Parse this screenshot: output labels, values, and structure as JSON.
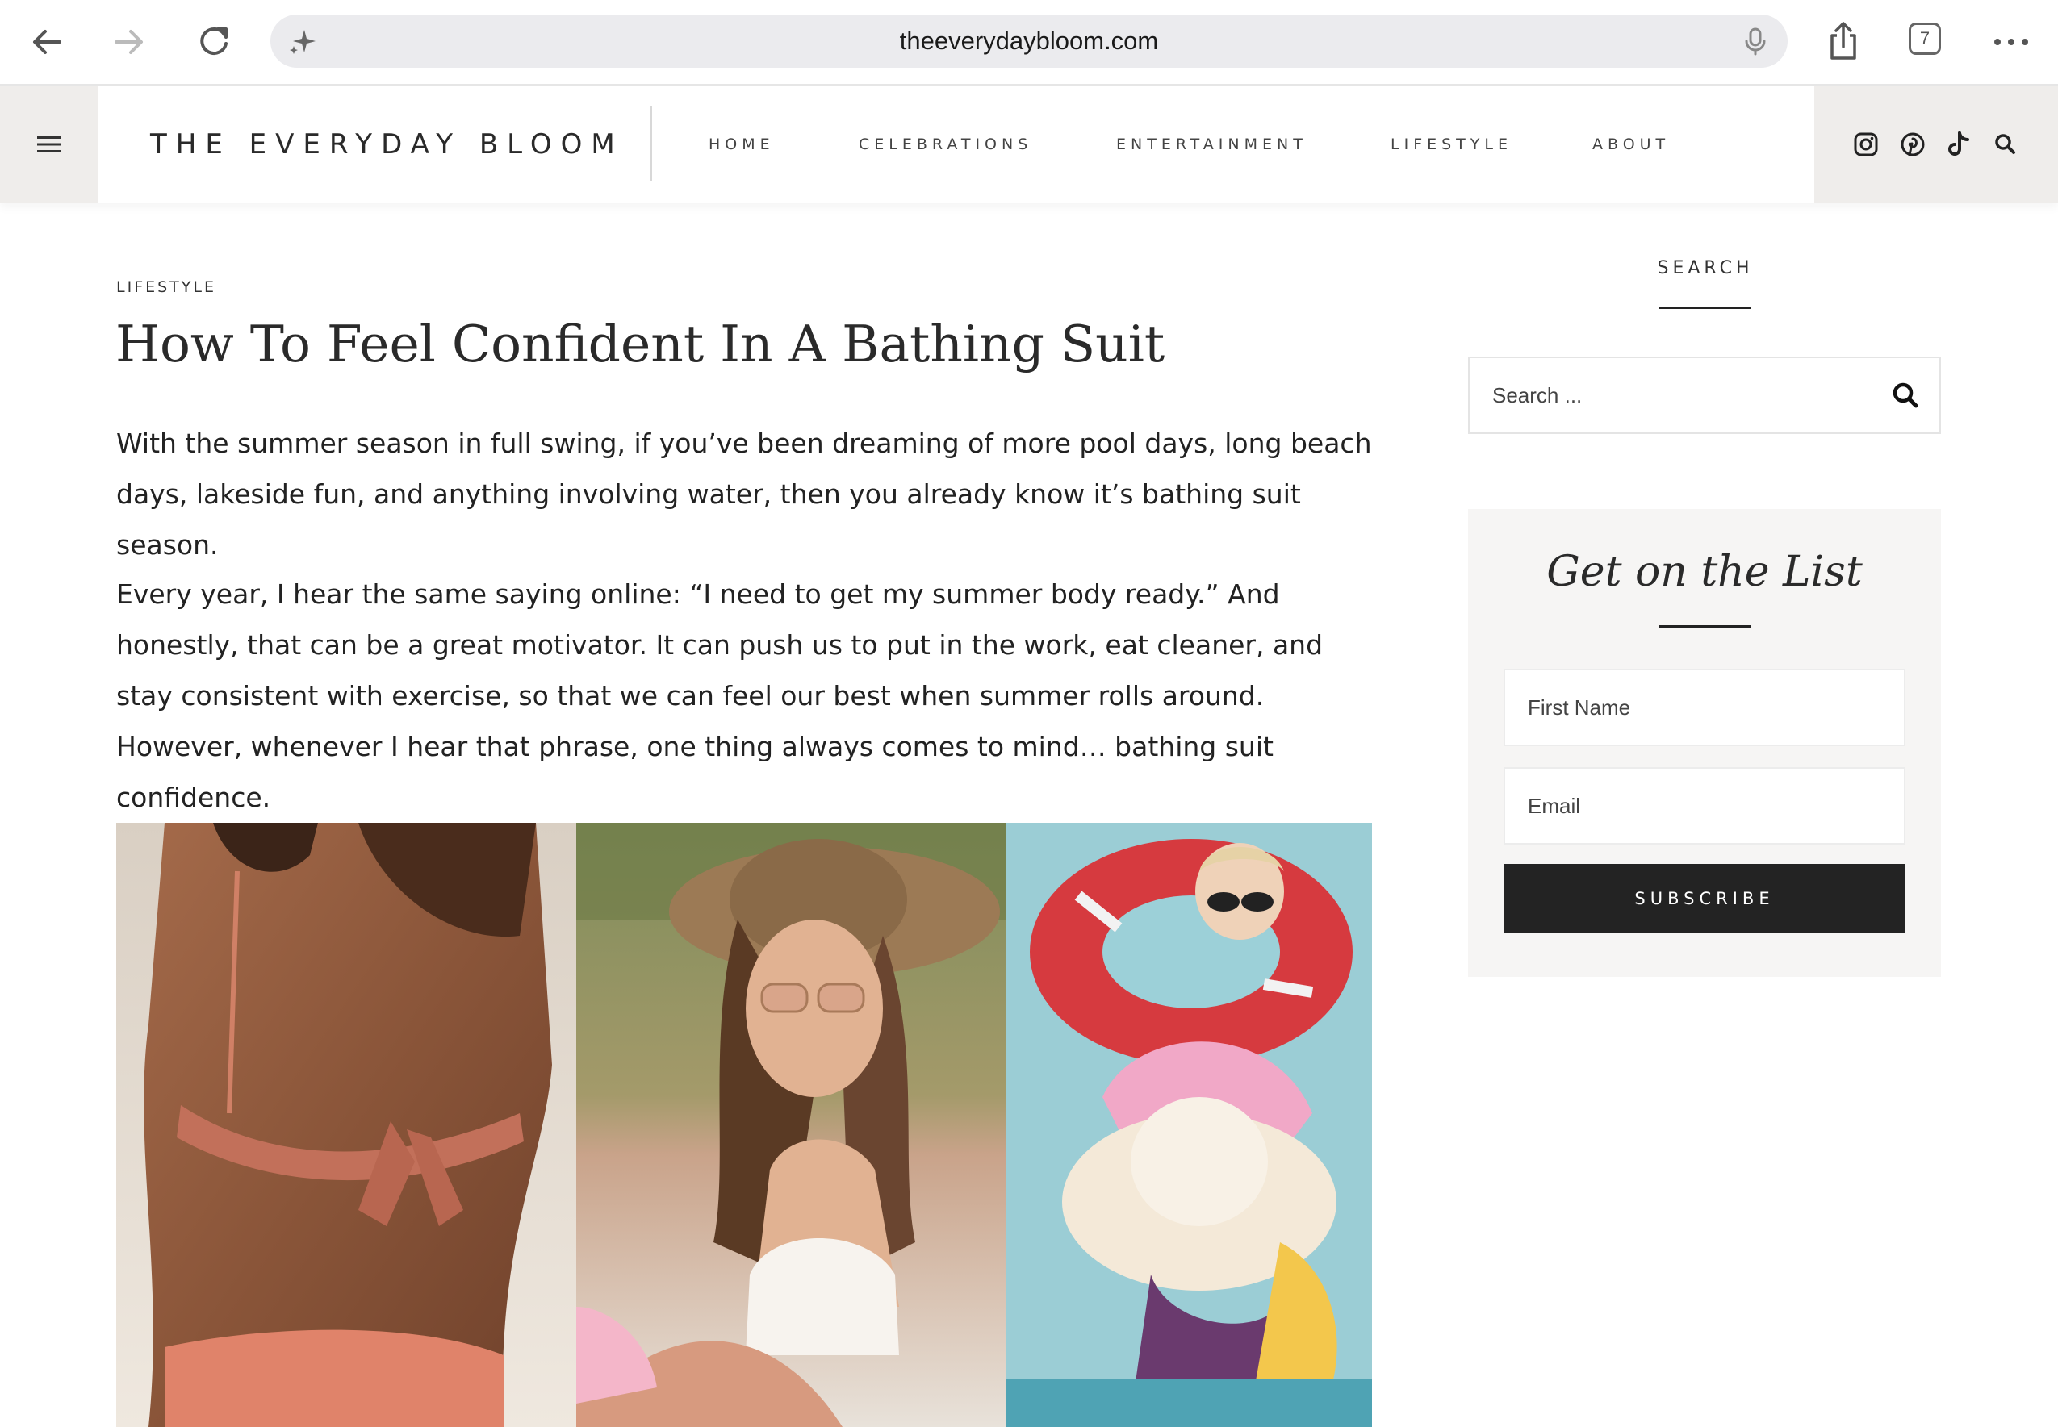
{
  "browser": {
    "url": "theeverydaybloom.com",
    "tab_count": "7",
    "icons": [
      "back-arrow-icon",
      "forward-arrow-icon",
      "reload-icon",
      "sparkle-icon",
      "microphone-icon",
      "share-icon",
      "tabs-icon",
      "more-icon"
    ]
  },
  "header": {
    "logo": "THE EVERYDAY BLOOM",
    "menu": [
      "HOME",
      "CELEBRATIONS",
      "ENTERTAINMENT",
      "LIFESTYLE",
      "ABOUT"
    ],
    "social_icons": [
      "instagram-icon",
      "pinterest-icon",
      "tiktok-icon",
      "search-icon"
    ]
  },
  "article": {
    "category": "LIFESTYLE",
    "title": "How To Feel Confident In A Bathing Suit",
    "paragraphs": [
      "With the summer season in full swing, if you’ve been dreaming of more pool days, long beach days, lakeside fun, and anything involving water, then you already know it’s bathing suit season.",
      "Every year, I hear the same saying online: “I need to get my summer body ready.” And honestly, that can be a great motivator. It can push us to put in the work, eat cleaner, and stay consistent with exercise, so that we can feel our best when summer rolls around. However, whenever I hear that phrase, one thing always comes to mind… bathing suit confidence."
    ]
  },
  "sidebar": {
    "search": {
      "heading": "SEARCH",
      "placeholder": "Search ..."
    },
    "newsletter": {
      "title": "Get on the List",
      "first_name_placeholder": "First Name",
      "email_placeholder": "Email",
      "submit_label": "SUBSCRIBE"
    }
  },
  "colors": {
    "accent_dark": "#232323",
    "header_grey": "#efedeb",
    "newsletter_bg": "#f6f5f4"
  }
}
